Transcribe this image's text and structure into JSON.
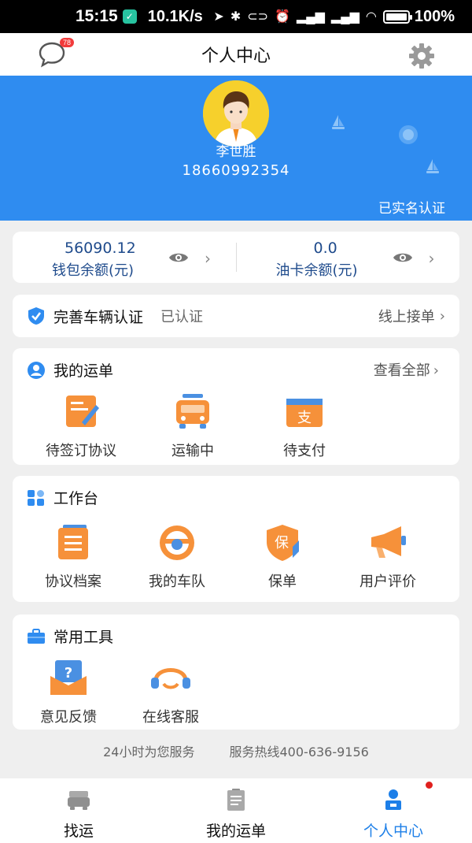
{
  "status_bar": {
    "time": "15:15",
    "network_speed": "10.1K/s",
    "battery": "100%",
    "icons": [
      "location-arrow-icon",
      "bluetooth-icon",
      "link-icon",
      "alarm-icon",
      "hd-signal-icon",
      "hd-signal-icon",
      "wifi-icon",
      "battery-icon"
    ]
  },
  "header": {
    "title": "个人中心",
    "message_badge": "78",
    "icons": [
      "message-icon",
      "gear-icon"
    ]
  },
  "profile": {
    "name": "李世胜",
    "phone": "18660992354",
    "verification": "已实名认证"
  },
  "wallet": {
    "balance": "56090.12",
    "balance_label": "钱包余额(元)",
    "fuel_balance": "0.0",
    "fuel_label": "油卡余额(元)"
  },
  "vehicle": {
    "title": "完善车辆认证",
    "status": "已认证",
    "link": "线上接单"
  },
  "orders": {
    "title": "我的运单",
    "more": "查看全部",
    "items": [
      {
        "label": "待签订协议",
        "icon": "contract-sign-icon"
      },
      {
        "label": "运输中",
        "icon": "truck-icon"
      },
      {
        "label": "待支付",
        "icon": "payment-icon"
      }
    ]
  },
  "workbench": {
    "title": "工作台",
    "items": [
      {
        "label": "协议档案",
        "icon": "archive-icon"
      },
      {
        "label": "我的车队",
        "icon": "steering-wheel-icon"
      },
      {
        "label": "保单",
        "icon": "insurance-shield-icon"
      },
      {
        "label": "用户评价",
        "icon": "megaphone-icon"
      }
    ]
  },
  "tools": {
    "title": "常用工具",
    "items": [
      {
        "label": "意见反馈",
        "icon": "feedback-icon"
      },
      {
        "label": "在线客服",
        "icon": "headset-icon"
      }
    ]
  },
  "footer": {
    "service_hours": "24小时为您服务",
    "hotline": "服务热线400-636-9156"
  },
  "tabbar": {
    "tabs": [
      {
        "label": "找运",
        "icon": "truck-tab-icon"
      },
      {
        "label": "我的运单",
        "icon": "clipboard-tab-icon"
      },
      {
        "label": "个人中心",
        "icon": "person-tab-icon",
        "active": true
      }
    ]
  },
  "colors": {
    "primary": "#2f8cf0",
    "accent_orange": "#f6913a",
    "text_dark_blue": "#1f4b8c",
    "active_tab": "#1d7fe8"
  }
}
